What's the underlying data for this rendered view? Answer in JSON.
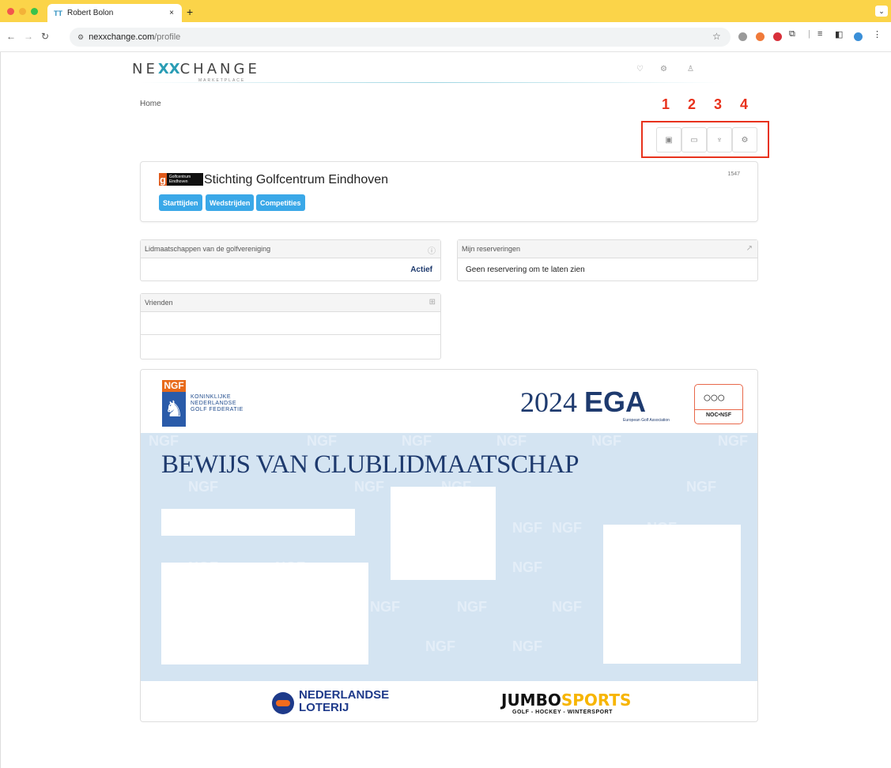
{
  "browser": {
    "tab_title": "Robert Bolon",
    "tab_favicon": "TT",
    "tab_close": "×",
    "new_tab": "+",
    "url_host": "nexxchange.com",
    "url_path": "/profile",
    "window_chevron": "⌄"
  },
  "site": {
    "logo_left": "NE",
    "logo_x": "XX",
    "logo_right": "CHANGE",
    "logo_sub": "MARKETPLACE"
  },
  "breadcrumb": "Home",
  "markers": [
    "1",
    "2",
    "3",
    "4"
  ],
  "club": {
    "logo_text": "Golfcentrum Eindhoven",
    "name": "Stichting Golfcentrum Eindhoven",
    "id": "1547",
    "buttons": [
      "Starttijden",
      "Wedstrijden",
      "Competities"
    ]
  },
  "panels": {
    "memberships": {
      "title": "Lidmaatschappen van de golfvereniging",
      "status": "Actief"
    },
    "reservations": {
      "title": "Mijn reserveringen",
      "empty": "Geen reservering om te laten zien"
    },
    "friends": {
      "title": "Vrienden"
    }
  },
  "card": {
    "ngf_label": "NGF",
    "ngf_line1": "KONINKLIJKE",
    "ngf_line2": "NEDERLANDSE",
    "ngf_line3": "GOLF FEDERATIE",
    "ega_year": "2024",
    "ega_word": "EGA",
    "ega_sub": "European Golf Association",
    "noc_label": "NOC•NSF",
    "title": "BEWIJS VAN CLUBLIDMAATSCHAP",
    "watermark": "NGF",
    "lotto_line1": "NEDERLANDSE",
    "lotto_line2": "LOTERIJ",
    "jumbo_a": "JUMBO",
    "jumbo_b": "SPORTS",
    "jumbo_sub": "GOLF - HOCKEY - WINTERSPORT"
  },
  "colors": {
    "titlebar": "#fbd449",
    "accent_button": "#3aa8e8",
    "marker_red": "#e8321c",
    "card_blue": "#d4e4f2",
    "navy": "#1e3a6e"
  }
}
